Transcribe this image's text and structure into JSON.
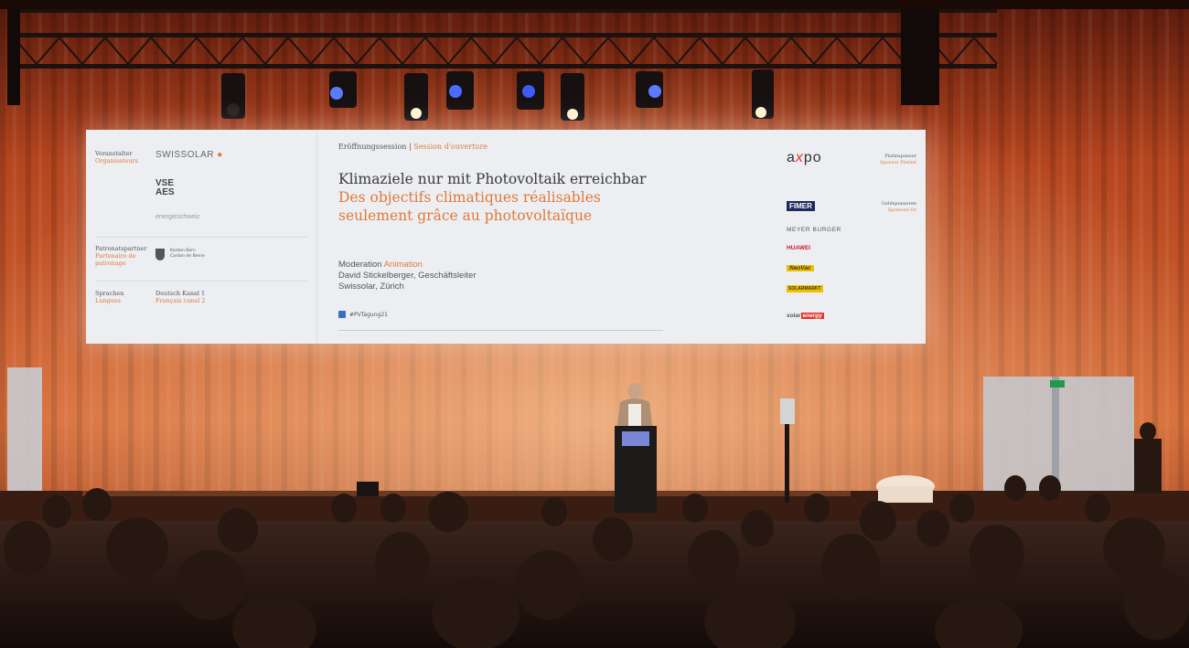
{
  "screen": {
    "left": {
      "organizer_label": "Veranstalter",
      "organizer_label_fr": "Organisateurs",
      "swissolar_logo": "SWISSOLAR",
      "vse_logo_top": "VSE",
      "vse_logo_bottom": "AES",
      "energie_logo": "energieschweiz",
      "patron_label": "Patronatspartner",
      "patron_label_fr": "Partenaire de patronage",
      "bern_text_1": "Kanton Bern",
      "bern_text_2": "Canton de Berne",
      "languages_label": "Sprachen",
      "languages_label_fr": "Langues",
      "channel_de": "Deutsch Kanal 1",
      "channel_fr": "Français canal 2"
    },
    "center": {
      "session_de": "Eröffnungssession",
      "session_sep": " | ",
      "session_fr": "Session d'ouverture",
      "title_de": "Klimaziele nur mit Photovoltaik erreichbar",
      "title_fr": "Des objectifs climatiques réalisables seulement grâce au photovoltaïque",
      "moderation_de": "Moderation",
      "moderation_fr": "Animation",
      "speaker": "David Stickelberger, Geschäftsleiter",
      "location": "Swissolar, Zürich",
      "hashtag": "#PVTagung21"
    },
    "right": {
      "axpo_a": "a",
      "axpo_z": "x",
      "axpo_po": "po",
      "platinum_label": "Platinsponsor",
      "platinum_label_fr": "Sponsor Platine",
      "gold_label": "Goldsponsoren",
      "gold_label_fr": "Sponsors Or",
      "sponsor_fimer": "FIMER",
      "sponsor_meyer": "MEYER BURGER",
      "sponsor_huawei": "HUAWEI",
      "sponsor_neovac": "NeoVac",
      "sponsor_solarmarkt": "SOLARMARKT",
      "sponsor_solar": "solar",
      "sponsor_solar_box": "energy"
    }
  },
  "colors": {
    "curtain": "#c2502a",
    "screen": "#eceef2",
    "accent": "#e07a3a",
    "stage_light": "#4a6cff"
  }
}
